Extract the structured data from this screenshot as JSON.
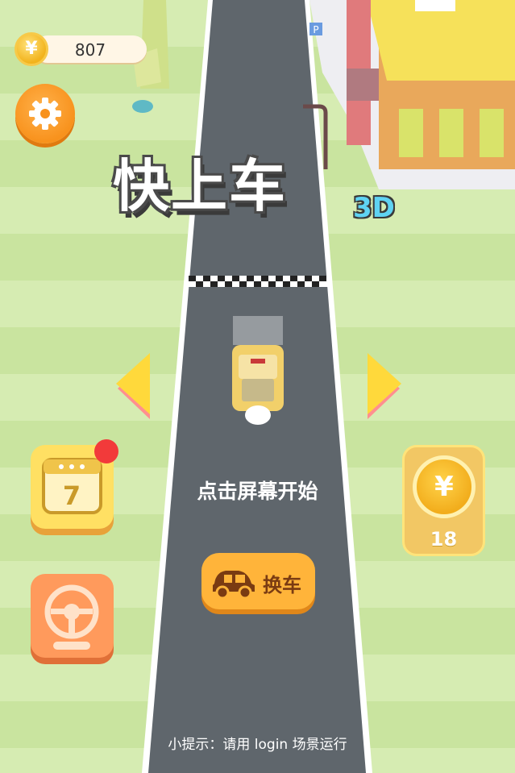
{
  "header": {
    "coin_symbol": "¥",
    "coin_count": "807"
  },
  "title": {
    "main": "快上车",
    "suffix": "3D"
  },
  "start_hint": "点击屏幕开始",
  "calendar": {
    "day": "7"
  },
  "coin_reward": {
    "symbol": "¥",
    "count": "18"
  },
  "change_car": {
    "label": "换车"
  },
  "footer_tip": "小提示：请用 login 场景运行",
  "building_sign": "P",
  "icons": [
    "coin-icon",
    "gear-icon",
    "calendar-icon",
    "steering-wheel-icon",
    "car-icon",
    "arrow-left-icon",
    "arrow-right-icon"
  ],
  "colors": {
    "grass_light": "#d6ecb2",
    "grass_dark": "#c9e49f",
    "road": "#5f666c",
    "accent_orange": "#f8921d",
    "accent_yellow": "#ffe063"
  }
}
